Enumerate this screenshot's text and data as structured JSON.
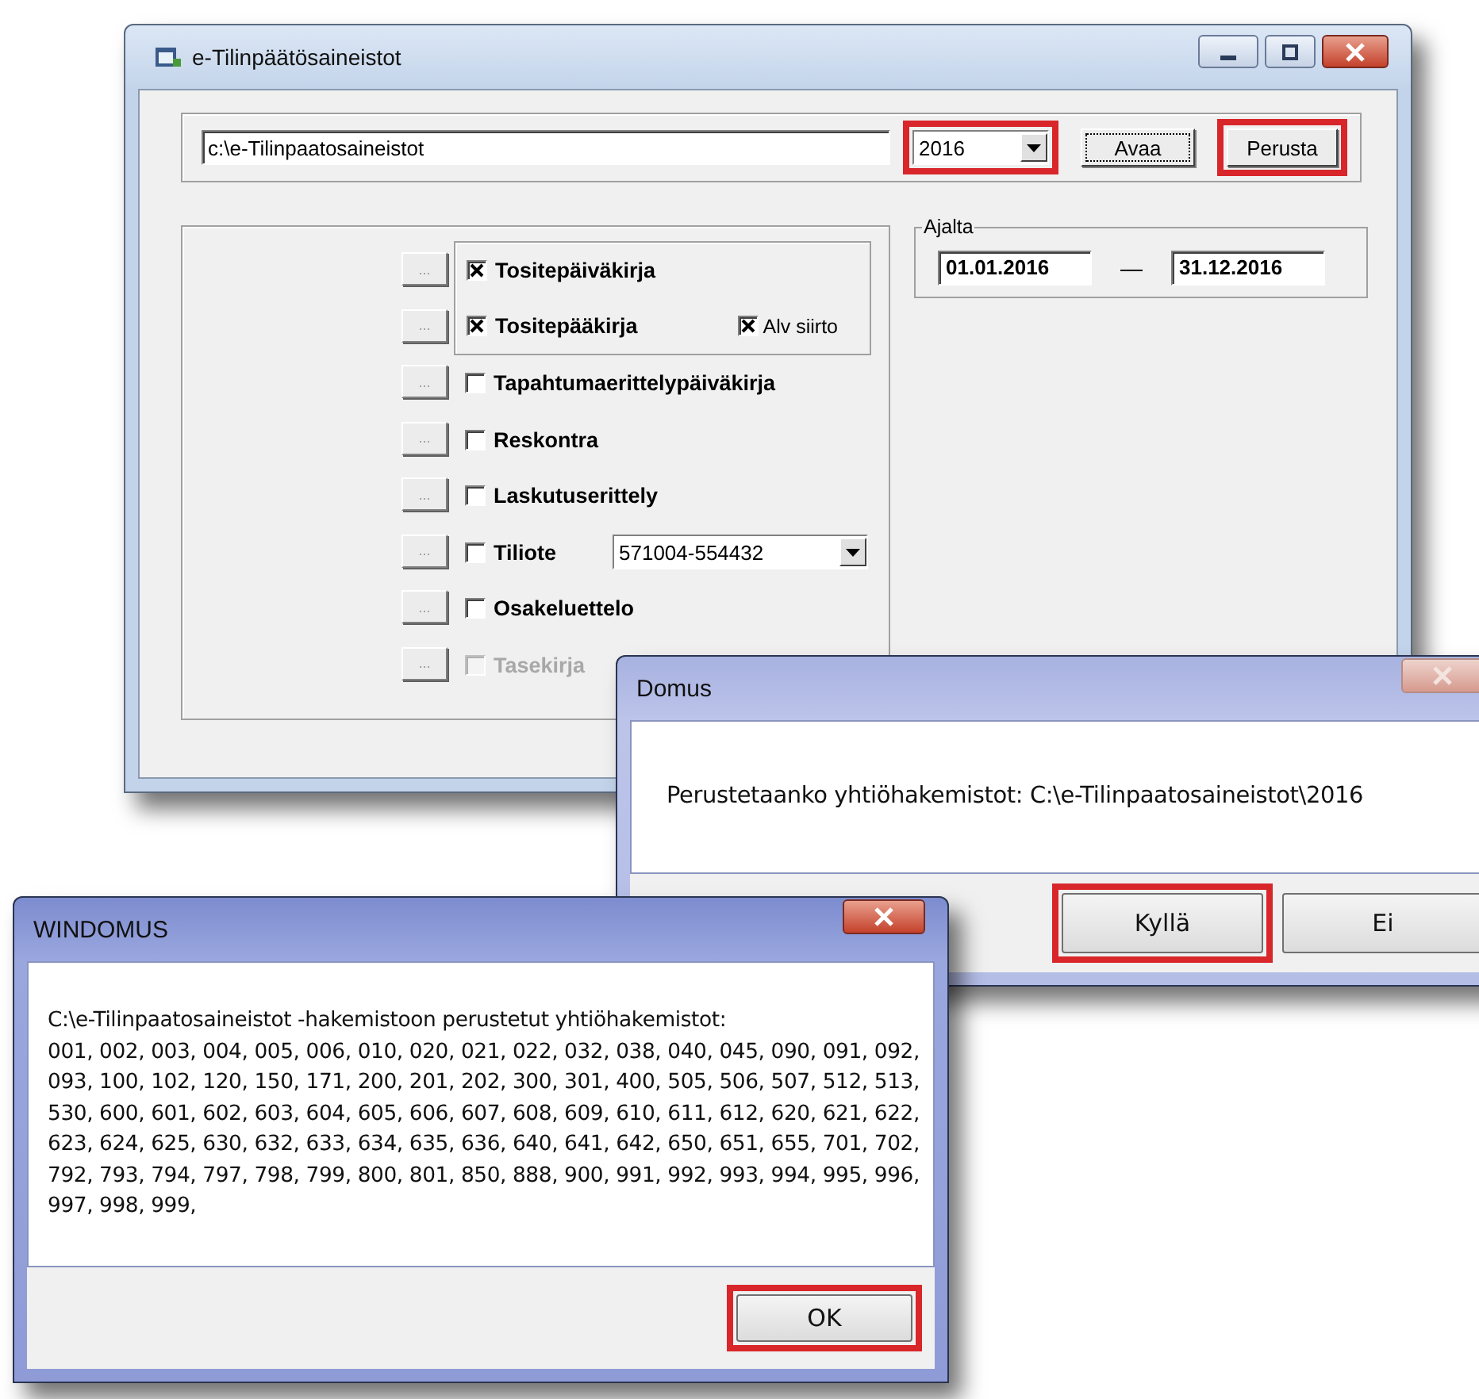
{
  "main_window": {
    "title": "e-Tilinpäätösaineistot",
    "path_field": {
      "value": "c:\\e-Tilinpaatosaineistot"
    },
    "year_select": {
      "value": "2016",
      "highlighted": true
    },
    "buttons": [
      {
        "label": "Avaa",
        "focused": true,
        "highlighted": false
      },
      {
        "label": "Perusta",
        "focused": false,
        "highlighted": true
      }
    ],
    "items": [
      {
        "kind": "check",
        "more": "...",
        "label": "Tositepäiväkirja",
        "checked": true,
        "disabled": false,
        "grouped": true
      },
      {
        "kind": "check",
        "more": "...",
        "label": "Tositepääkirja",
        "checked": true,
        "disabled": false,
        "grouped": true,
        "option": {
          "label": "Alv siirto",
          "checked": true
        }
      },
      {
        "kind": "check",
        "more": "...",
        "label": "Tapahtumaerittelypäiväkirja",
        "checked": false,
        "disabled": false,
        "grouped": false
      },
      {
        "kind": "check",
        "more": "...",
        "label": "Reskontra",
        "checked": false,
        "disabled": false,
        "grouped": false
      },
      {
        "kind": "check",
        "more": "...",
        "label": "Laskutuserittely",
        "checked": false,
        "disabled": false,
        "grouped": false
      },
      {
        "kind": "select",
        "more": "...",
        "label": "Tiliote",
        "checked": false,
        "disabled": false,
        "grouped": false,
        "select_value": "571004-554432"
      },
      {
        "kind": "check",
        "more": "...",
        "label": "Osakeluettelo",
        "checked": false,
        "disabled": false,
        "grouped": false
      },
      {
        "kind": "check",
        "more": "...",
        "label": "Tasekirja",
        "checked": false,
        "disabled": true,
        "grouped": false
      }
    ],
    "period": {
      "label": "Ajalta",
      "from": "01.01.2016",
      "separator": "—",
      "to": "31.12.2016"
    }
  },
  "dialogs": [
    {
      "title": "Domus",
      "active": false,
      "message_lines": [
        "Perustetaanko yhtiöhakemistot: C:\\e-Tilinpaatosaineistot\\2016"
      ],
      "buttons": [
        {
          "label": "Kyllä",
          "highlighted": true
        },
        {
          "label": "Ei",
          "highlighted": false
        }
      ]
    },
    {
      "title": "WINDOMUS",
      "active": true,
      "message_lines": [
        "C:\\e-Tilinpaatosaineistot -hakemistoon perustetut yhtiöhakemistot:",
        "001, 002, 003, 004, 005, 006, 010, 020, 021, 022, 032, 038, 040, 045, 090, 091, 092,",
        "093, 100, 102, 120, 150, 171, 200, 201, 202, 300, 301, 400, 505, 506, 507, 512, 513,",
        "530, 600, 601, 602, 603, 604, 605, 606, 607, 608, 609, 610, 611, 612, 620, 621, 622,",
        "623, 624, 625, 630, 632, 633, 634, 635, 636, 640, 641, 642, 650, 651, 655, 701, 702,",
        "792, 793, 794, 797, 798, 799, 800, 801, 850, 888, 900, 991, 992, 993, 994, 995, 996,",
        "997, 998, 999,"
      ],
      "buttons": [
        {
          "label": "OK",
          "highlighted": true
        }
      ]
    }
  ]
}
